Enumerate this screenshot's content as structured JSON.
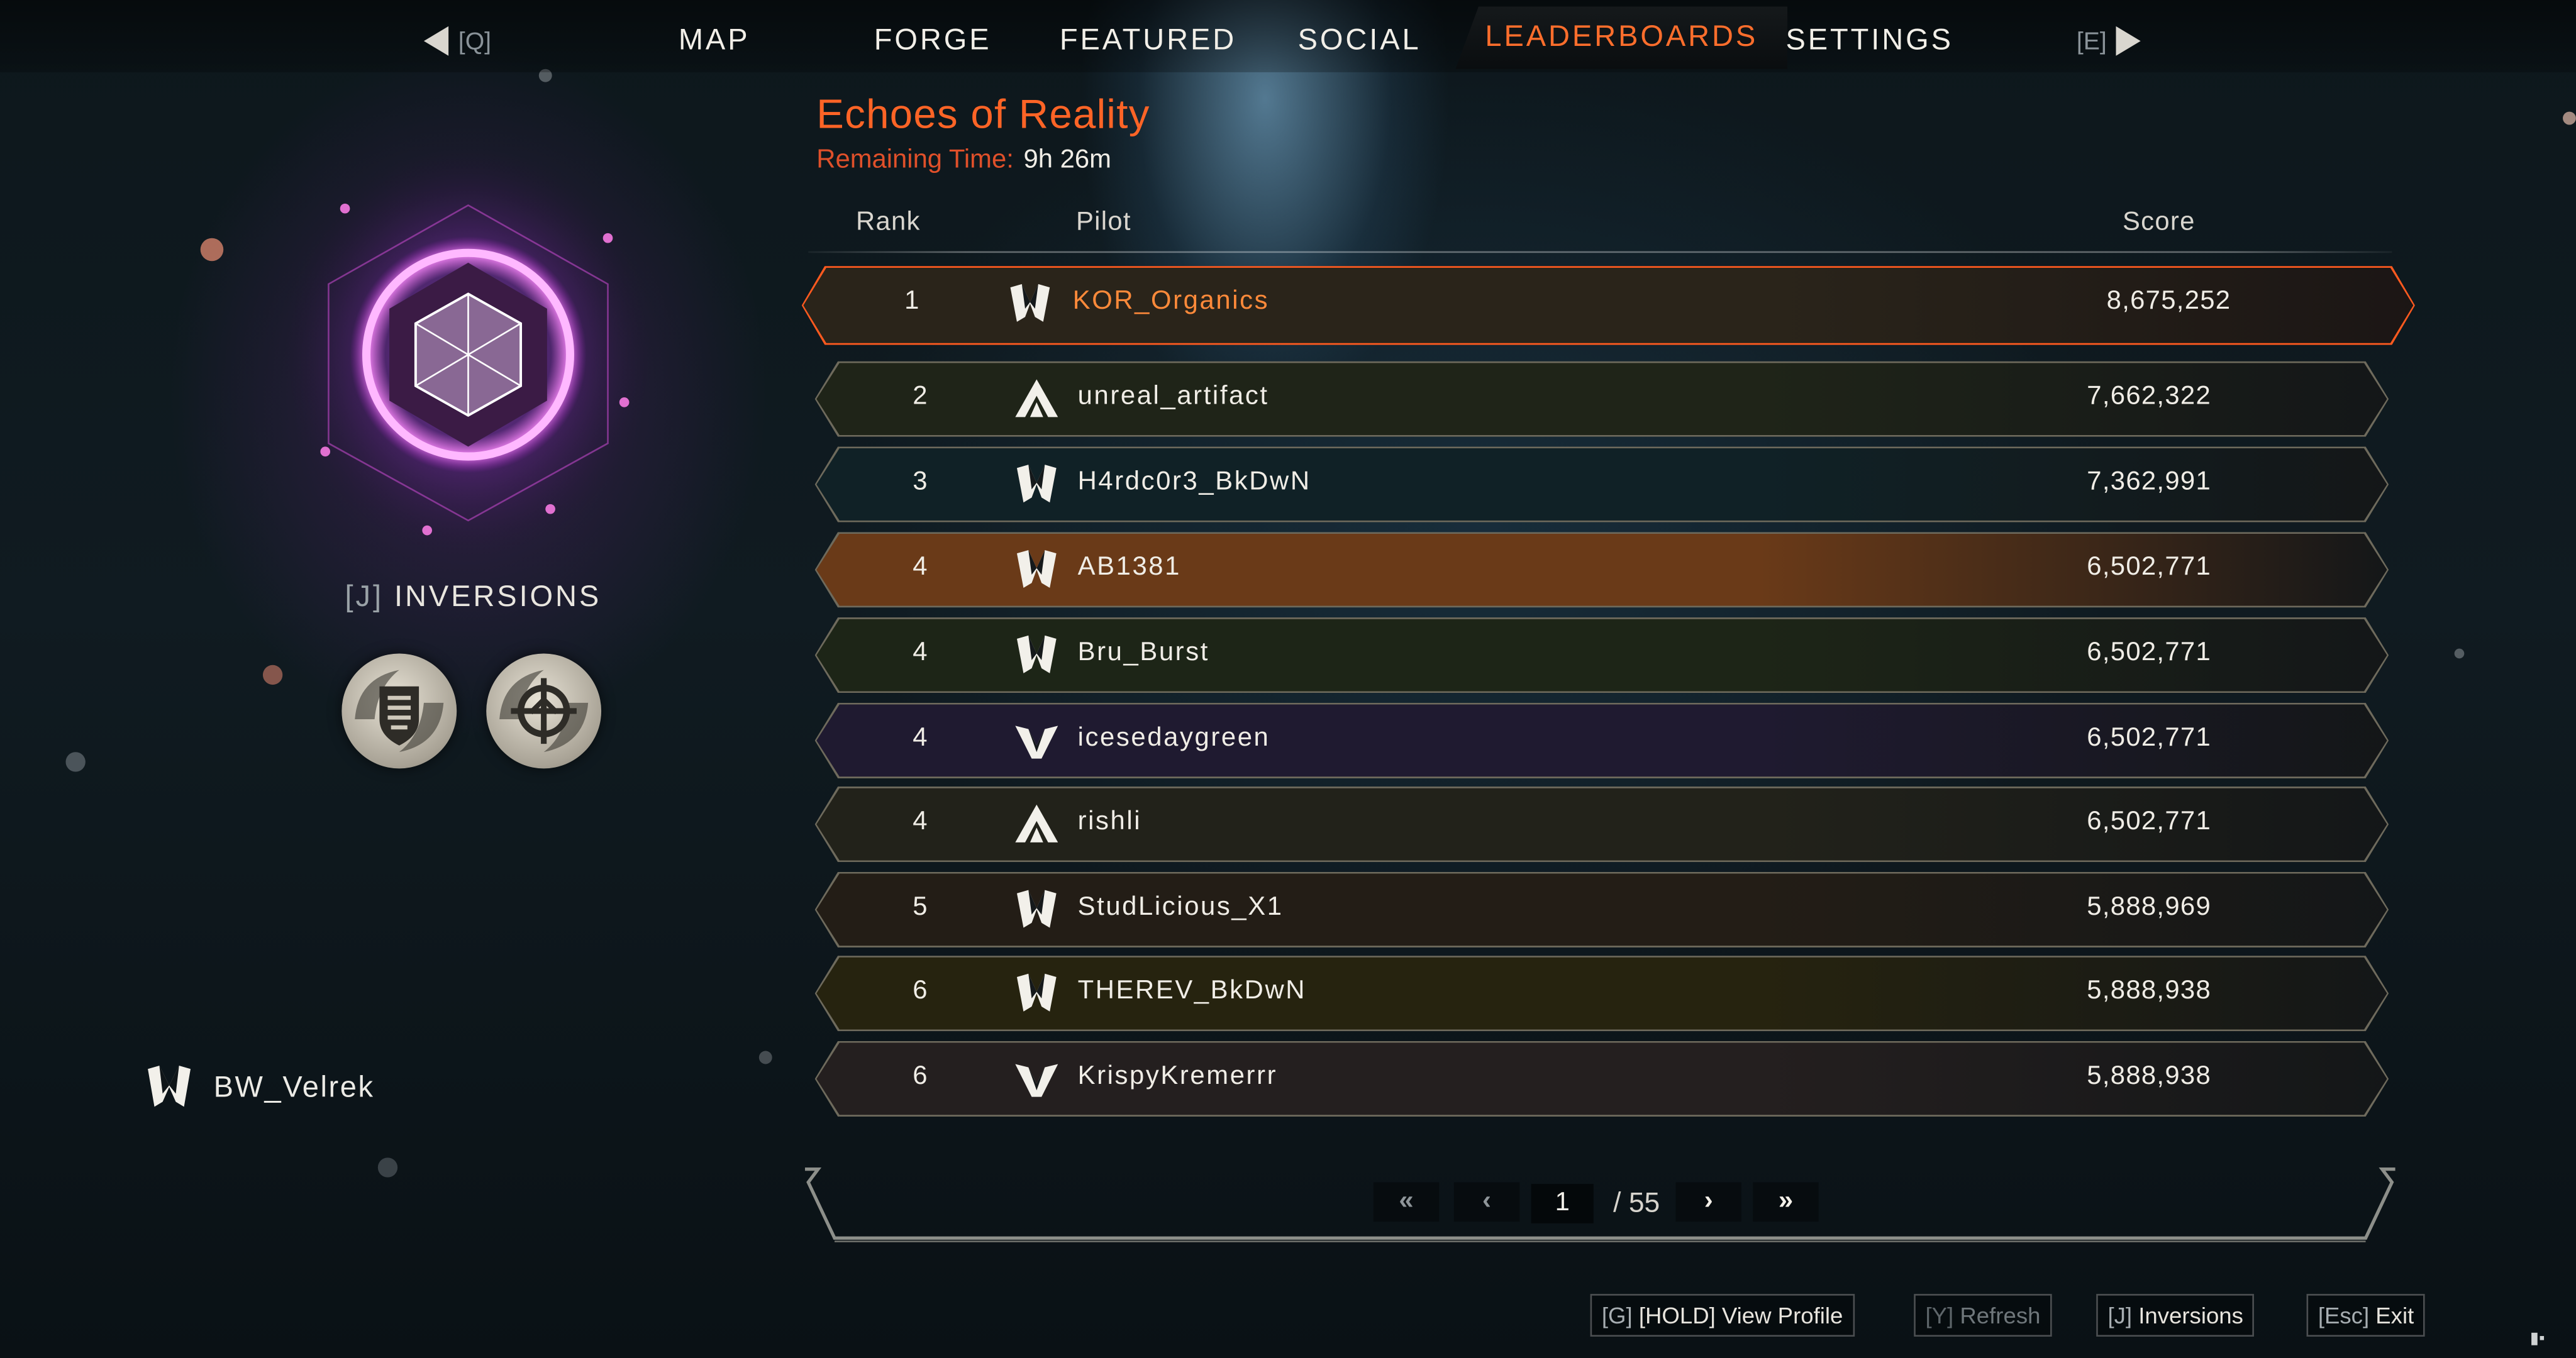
{
  "nav": {
    "prev_key": "[Q]",
    "next_key": "[E]",
    "tabs": [
      {
        "label": "MAP"
      },
      {
        "label": "FORGE"
      },
      {
        "label": "FEATURED"
      },
      {
        "label": "SOCIAL"
      },
      {
        "label": "LEADERBOARDS",
        "active": true
      },
      {
        "label": "SETTINGS"
      }
    ]
  },
  "emblem": {
    "key": "[J]",
    "label": "INVERSIONS",
    "badges": [
      "shield-badge-icon",
      "target-badge-icon"
    ]
  },
  "player": {
    "name": "BW_Velrek",
    "icon": "interceptor-javelin-icon"
  },
  "event": {
    "title": "Echoes of Reality",
    "remaining_label": "Remaining Time:",
    "remaining_value": "9h 26m"
  },
  "columns": {
    "rank": "Rank",
    "pilot": "Pilot",
    "score": "Score"
  },
  "rows": [
    {
      "rank": "1",
      "pilot": "KOR_Organics",
      "score": "8,675,252",
      "icon": "interceptor-javelin-icon",
      "tint": "#2a241a"
    },
    {
      "rank": "2",
      "pilot": "unreal_artifact",
      "score": "7,662,322",
      "icon": "ranger-javelin-icon",
      "tint": "#1f2418"
    },
    {
      "rank": "3",
      "pilot": "H4rdc0r3_BkDwN",
      "score": "7,362,991",
      "icon": "interceptor-javelin-icon",
      "tint": "#102126"
    },
    {
      "rank": "4",
      "pilot": "AB1381",
      "score": "6,502,771",
      "icon": "interceptor-javelin-icon",
      "tint": "#6a3a18"
    },
    {
      "rank": "4",
      "pilot": "Bru_Burst",
      "score": "6,502,771",
      "icon": "interceptor-javelin-icon",
      "tint": "#1d2517"
    },
    {
      "rank": "4",
      "pilot": "icesedaygreen",
      "score": "6,502,771",
      "icon": "storm-javelin-icon",
      "tint": "#1f1a30"
    },
    {
      "rank": "4",
      "pilot": "rishli",
      "score": "6,502,771",
      "icon": "ranger-javelin-icon",
      "tint": "#22221a"
    },
    {
      "rank": "5",
      "pilot": "StudLicious_X1",
      "score": "5,888,969",
      "icon": "interceptor-javelin-icon",
      "tint": "#231d16"
    },
    {
      "rank": "6",
      "pilot": "THEREV_BkDwN",
      "score": "5,888,938",
      "icon": "interceptor-javelin-icon",
      "tint": "#26230f"
    },
    {
      "rank": "6",
      "pilot": "KrispyKremerrr",
      "score": "5,888,938",
      "icon": "storm-javelin-icon",
      "tint": "#241f1f"
    }
  ],
  "pager": {
    "current": "1",
    "total": "/ 55",
    "first": "«",
    "prev": "‹",
    "next": "›",
    "last": "»"
  },
  "hints": [
    {
      "key": "[G]",
      "label": "[HOLD] View Profile",
      "enabled": true
    },
    {
      "key": "[Y]",
      "label": "Refresh",
      "enabled": false
    },
    {
      "key": "[J]",
      "label": "Inversions",
      "enabled": true
    },
    {
      "key": "[Esc]",
      "label": "Exit",
      "enabled": true
    }
  ],
  "colors": {
    "accent": "#ff6426",
    "row_border": "#6e6a5c",
    "active_border": "#ff5a1f"
  }
}
